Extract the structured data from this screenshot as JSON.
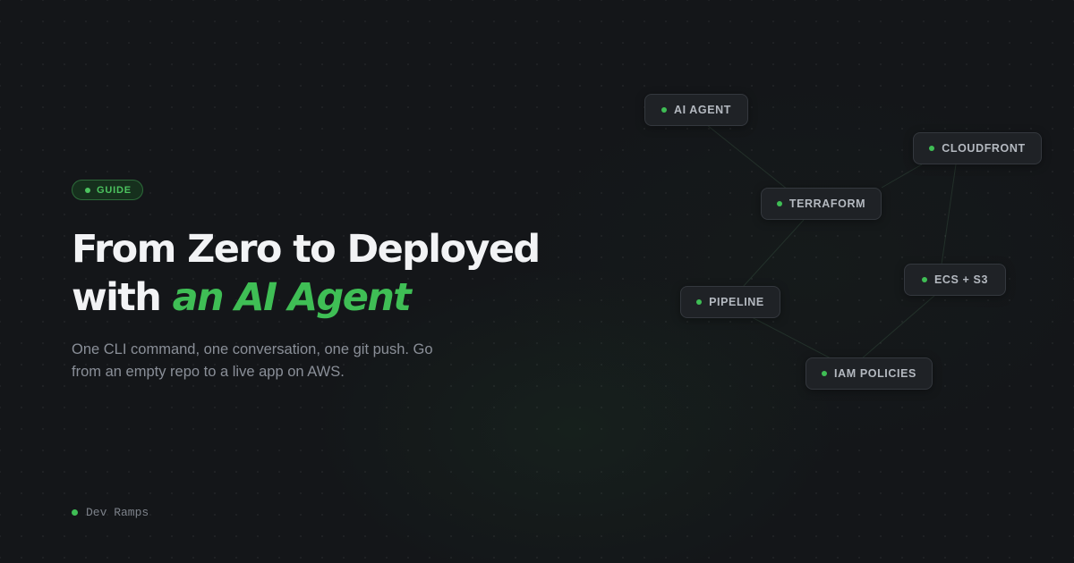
{
  "badge": {
    "label": "GUIDE"
  },
  "headline": {
    "line1": "From Zero to Deployed",
    "line2_plain": "with ",
    "line2_accent": "an AI Agent"
  },
  "subtitle": "One CLI command, one conversation, one git push. Go from an empty repo to a live app on AWS.",
  "brand": {
    "name": "Dev Ramps"
  },
  "nodes": {
    "ai_agent": "AI AGENT",
    "cloudfront": "CLOUDFRONT",
    "terraform": "TERRAFORM",
    "ecs_s3": "ECS + S3",
    "pipeline": "PIPELINE",
    "iam_policies": "IAM POLICIES"
  },
  "colors": {
    "background": "#141619",
    "accent": "#3fbe55",
    "node_bg": "#1f2226",
    "node_border": "#34383e"
  }
}
